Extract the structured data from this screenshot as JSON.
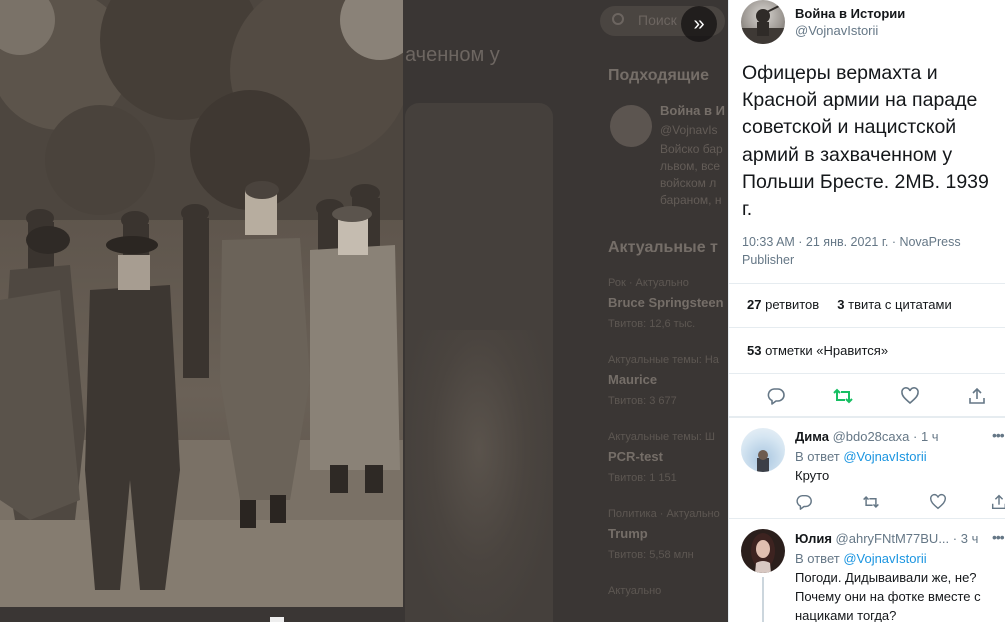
{
  "background": {
    "search_placeholder": "Поиск",
    "headline_fragment": "аченном у",
    "recommended_title": "Подходящие",
    "recommended": {
      "name": "Война в И",
      "handle": "@VojnavIs",
      "text_lines": [
        "Войско бар",
        "львом, все",
        "войском л",
        "бараном, н"
      ]
    },
    "trends_title": "Актуальные т",
    "trends": [
      {
        "context": "Рок · Актуально",
        "name": "Bruce Springsteen",
        "count": "Твитов: 12,6 тыс."
      },
      {
        "context": "Актуальные темы: На",
        "name": "Maurice",
        "count": "Твитов: 3 677"
      },
      {
        "context": "Актуальные темы: Ш",
        "name": "PCR-test",
        "count": "Твитов: 1 151"
      },
      {
        "context": "Политика · Актуально",
        "name": "Trump",
        "count": "Твитов: 5,58 млн"
      },
      {
        "context": "Актуально",
        "name": "",
        "count": ""
      }
    ]
  },
  "photo": {
    "expand_icon": "double-chevron-right-icon"
  },
  "tweet": {
    "author_name": "Война в Истории",
    "author_handle": "@VojnavIstorii",
    "text": "Офицеры вермахта и Красной армии на параде советской и нацистской армий в захваченном у Польши Бресте. 2МВ. 1939 г.",
    "timestamp": "10:33 AM · 21 янв. 2021 г. · ",
    "source": "NovaPress Publisher",
    "retweets_count": "27",
    "retweets_label": "ретвитов",
    "quotes_count": "3",
    "quotes_label": "твита с цитатами",
    "likes_count": "53",
    "likes_label": "отметки «Нравится»"
  },
  "replies": [
    {
      "name": "Дима",
      "handle": "@bdo28caxa",
      "time": "· 1 ч",
      "reply_to_prefix": "В ответ ",
      "reply_to": "@VojnavIstorii",
      "text": "Круто"
    },
    {
      "name": "Юлия",
      "handle": "@ahryFNtM77BU...",
      "time": "· 3 ч",
      "reply_to_prefix": "В ответ ",
      "reply_to": "@VojnavIstorii",
      "text": "Погоди. Дидываивали же, не? Почему они на фотке вместе с нациками тогда?"
    }
  ],
  "colors": {
    "accent": "#1b95e0",
    "retweet_green": "#17bf63",
    "text": "#14171a",
    "secondary": "#657786",
    "border": "#e6ecf0",
    "backdrop": "#3a3634"
  }
}
